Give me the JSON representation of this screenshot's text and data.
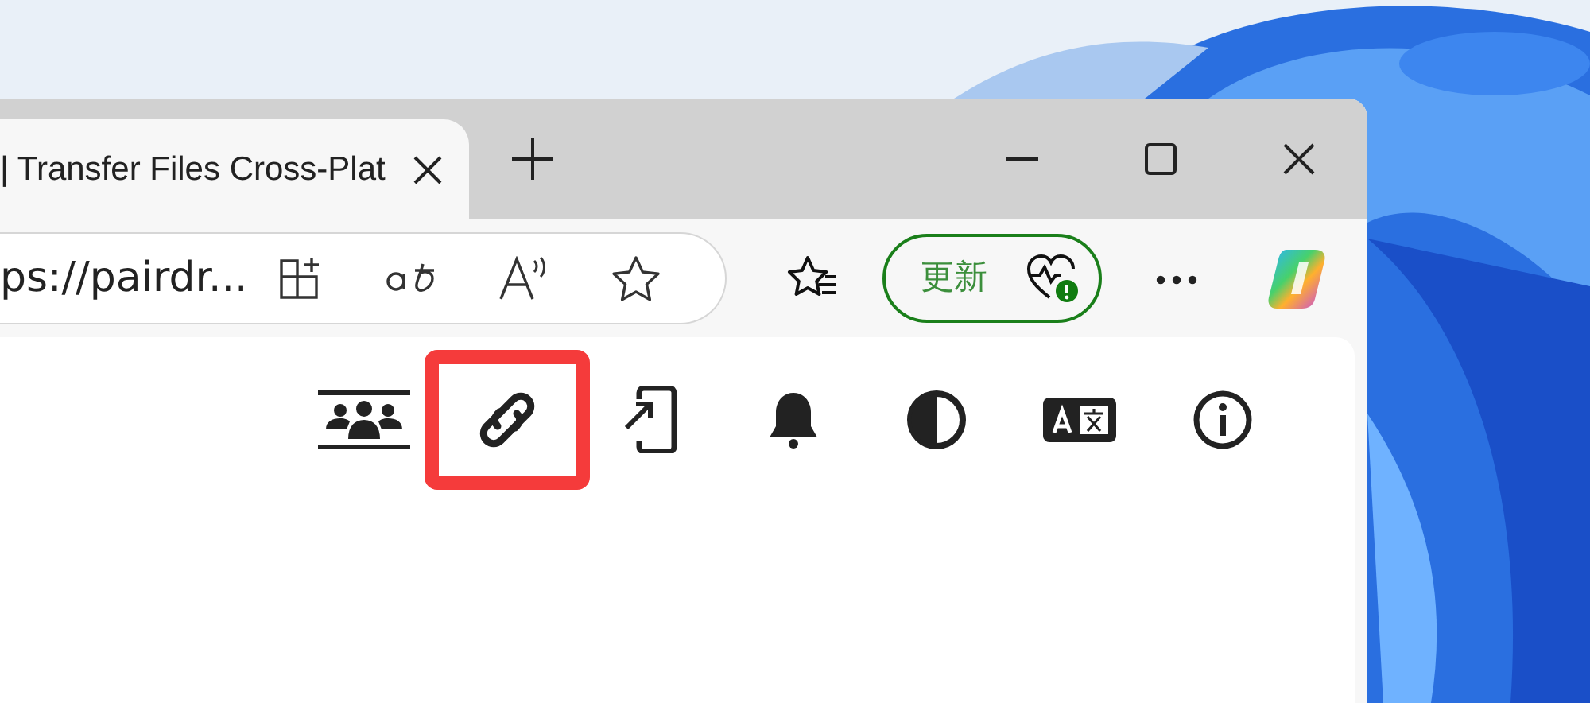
{
  "tab": {
    "title": "| Transfer Files Cross-Plat",
    "selected": true
  },
  "address_bar": {
    "url": "ps://pairdr..."
  },
  "update_button": {
    "label": "更新"
  },
  "page_toolbar": [
    {
      "kind": "people",
      "highlighted": false
    },
    {
      "kind": "link",
      "highlighted": true
    },
    {
      "kind": "install",
      "highlighted": false
    },
    {
      "kind": "bell",
      "highlighted": false
    },
    {
      "kind": "contrast",
      "highlighted": false
    },
    {
      "kind": "translate",
      "highlighted": false
    },
    {
      "kind": "info",
      "highlighted": false
    }
  ]
}
